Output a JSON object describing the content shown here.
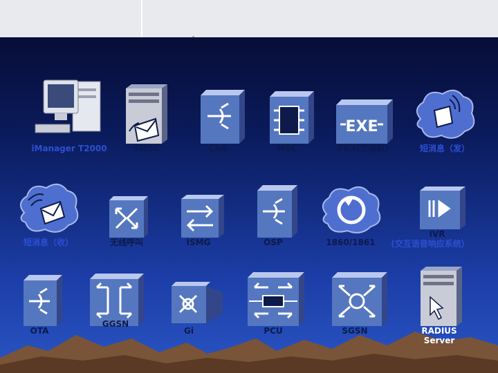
{
  "nodes": {
    "imanager": "iManager T2000",
    "smsc": "SMSC",
    "caa": "CAA",
    "msc": "MSC",
    "pbx": "PBX(交换机)",
    "sms_send": "短消息（发）",
    "sms_recv": "短消息（收）",
    "wireless_call": "无线呼叫",
    "ismg": "ISMG",
    "osp": "OSP",
    "n1860": "1860/1861",
    "ivr": "IVR",
    "ivr_sub": "(交互语音响应系统）",
    "ota": "OTA",
    "ggsn": "GGSN",
    "gi": "Gi",
    "pcu": "PCU",
    "sgsn": "SGSN",
    "radius_line1": "RADIUS",
    "radius_line2": "Server"
  },
  "icons": {
    "exe": "EXE"
  },
  "colors": {
    "label_blue": "#2c4fd0",
    "label_dark": "#0d1a4a",
    "cube_front": "#5577c0",
    "cube_top": "#b9c8ee",
    "cloud": "#4e6ed0"
  }
}
